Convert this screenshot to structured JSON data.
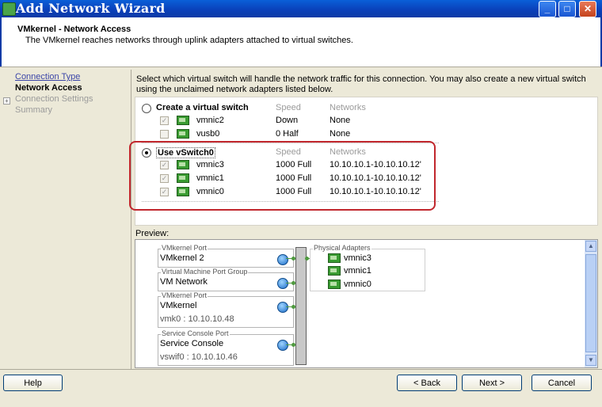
{
  "window": {
    "title": "Add Network Wizard",
    "minimize_label": "_",
    "maximize_label": "□",
    "close_label": "✕"
  },
  "header": {
    "title": "VMkernel - Network Access",
    "subtitle": "The VMkernel reaches networks through uplink adapters attached to virtual switches."
  },
  "nav": {
    "items": [
      {
        "label": "Connection Type",
        "state": "link"
      },
      {
        "label": "Network Access",
        "state": "current"
      },
      {
        "label": "Connection Settings",
        "state": "disabled"
      },
      {
        "label": "Summary",
        "state": "disabled"
      }
    ],
    "expand_glyph": "+"
  },
  "instructions": "Select which virtual switch will handle the network traffic for this connection. You may also create a new virtual switch using the unclaimed network adapters listed below.",
  "switch_options": {
    "create": {
      "label": "Create a virtual switch",
      "speed_header": "Speed",
      "networks_header": "Networks",
      "adapters": [
        {
          "name": "vmnic2",
          "speed": "Down",
          "networks": "None"
        },
        {
          "name": "vusb0",
          "speed": "0 Half",
          "networks": "None"
        }
      ]
    },
    "use": {
      "label": "Use vSwitch0",
      "speed_header": "Speed",
      "networks_header": "Networks",
      "adapters": [
        {
          "name": "vmnic3",
          "speed": "1000 Full",
          "networks": "10.10.10.1-10.10.10.12'"
        },
        {
          "name": "vmnic1",
          "speed": "1000 Full",
          "networks": "10.10.10.1-10.10.10.12'"
        },
        {
          "name": "vmnic0",
          "speed": "1000 Full",
          "networks": "10.10.10.1-10.10.10.12'"
        }
      ]
    },
    "check_glyph": "✓",
    "selected": "use"
  },
  "preview": {
    "label": "Preview:",
    "port_groups": [
      {
        "legend": "VMkernel Port",
        "name": "VMkernel 2",
        "sub": ""
      },
      {
        "legend": "Virtual Machine Port Group",
        "name": "VM Network",
        "sub": ""
      },
      {
        "legend": "VMkernel Port",
        "name": "VMkernel",
        "sub": "vmk0 : 10.10.10.48"
      },
      {
        "legend": "Service Console Port",
        "name": "Service Console",
        "sub": "vswif0 : 10.10.10.46"
      }
    ],
    "physical_adapters": {
      "legend": "Physical Adapters",
      "items": [
        "vmnic3",
        "vmnic1",
        "vmnic0"
      ]
    },
    "scroll_up": "▲",
    "scroll_down": "▼"
  },
  "buttons": {
    "help": "Help",
    "back": "< Back",
    "next": "Next >",
    "cancel": "Cancel"
  },
  "colors": {
    "title_bar": "#0a3fb8",
    "highlight_border": "#c1272d",
    "link": "#3c46a8",
    "nic_icon": "#3a9b32"
  }
}
